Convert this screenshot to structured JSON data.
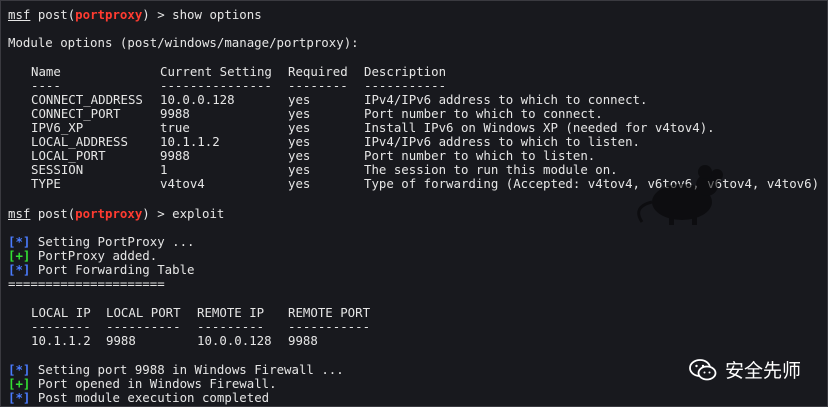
{
  "prompt": {
    "user": "msf",
    "module": "portproxy"
  },
  "lines": {
    "cmd1": "show options",
    "module_header": "Module options (post/windows/manage/portproxy):",
    "cmd2": "exploit",
    "msg1_marker": "[*]",
    "msg1": "Setting PortProxy ...",
    "msg2_marker": "[+]",
    "msg2": "PortProxy added.",
    "msg3_marker": "[*]",
    "msg3": "Port Forwarding Table",
    "separator": "=====================",
    "msg4_marker": "[*]",
    "msg4": "Setting port 9988 in Windows Firewall ...",
    "msg5_marker": "[+]",
    "msg5": "Port opened in Windows Firewall.",
    "msg6_marker": "[*]",
    "msg6": "Post module execution completed"
  },
  "options_table": {
    "headers": {
      "name": "Name",
      "current": "Current Setting",
      "required": "Required",
      "description": "Description"
    },
    "underlines": {
      "name": "----",
      "current": "---------------",
      "required": "--------",
      "description": "-----------"
    },
    "rows": [
      {
        "name": "CONNECT_ADDRESS",
        "current": "10.0.0.128",
        "required": "yes",
        "description": "IPv4/IPv6 address to which to connect."
      },
      {
        "name": "CONNECT_PORT",
        "current": "9988",
        "required": "yes",
        "description": "Port number to which to connect."
      },
      {
        "name": "IPV6_XP",
        "current": "true",
        "required": "yes",
        "description": "Install IPv6 on Windows XP (needed for v4tov4)."
      },
      {
        "name": "LOCAL_ADDRESS",
        "current": "10.1.1.2",
        "required": "yes",
        "description": "IPv4/IPv6 address to which to listen."
      },
      {
        "name": "LOCAL_PORT",
        "current": "9988",
        "required": "yes",
        "description": "Port number to which to listen."
      },
      {
        "name": "SESSION",
        "current": "1",
        "required": "yes",
        "description": "The session to run this module on."
      },
      {
        "name": "TYPE",
        "current": "v4tov4",
        "required": "yes",
        "description": "Type of forwarding (Accepted: v4tov4, v6tov6, v6tov4, v4tov6)"
      }
    ]
  },
  "forward_table": {
    "headers": {
      "local_ip": "LOCAL IP",
      "local_port": "LOCAL PORT",
      "remote_ip": "REMOTE IP",
      "remote_port": "REMOTE PORT"
    },
    "underlines": {
      "local_ip": "--------",
      "local_port": "----------",
      "remote_ip": "---------",
      "remote_port": "-----------"
    },
    "rows": [
      {
        "local_ip": "10.1.1.2",
        "local_port": "9988",
        "remote_ip": "10.0.0.128",
        "remote_port": "9988"
      }
    ]
  },
  "watermark": {
    "text": "安全先师",
    "icon": "wechat-icon"
  },
  "colors": {
    "background": "#18191e",
    "module_red": "#ff3b30",
    "info_blue": "#4a7cff",
    "success_green": "#33e033"
  }
}
